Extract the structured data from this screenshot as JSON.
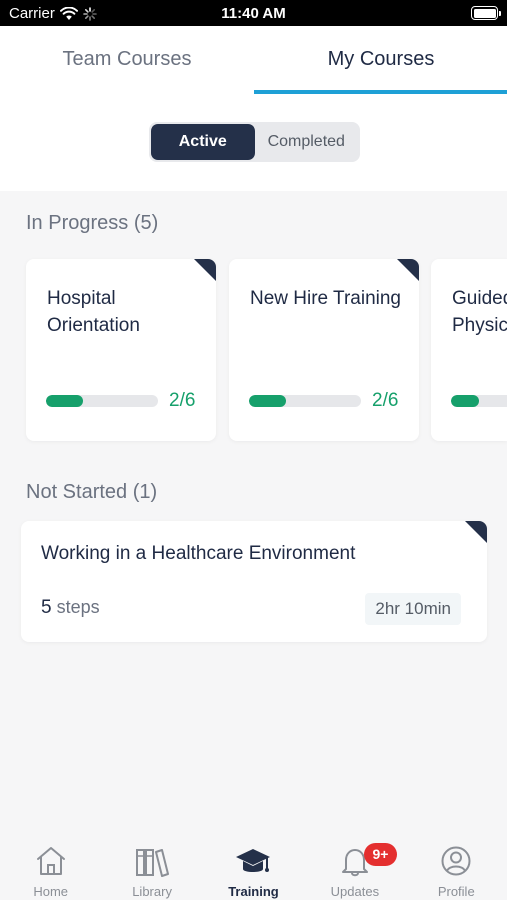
{
  "status_bar": {
    "carrier": "Carrier",
    "time": "11:40 AM"
  },
  "tabs": [
    {
      "label": "Team Courses",
      "selected": false
    },
    {
      "label": "My Courses",
      "selected": true
    }
  ],
  "filter": {
    "active_label": "Active",
    "completed_label": "Completed",
    "selected": "Active"
  },
  "in_progress": {
    "title": "In Progress (5)",
    "cards": [
      {
        "title": "Hospital Orientation",
        "progress_text": "2/6",
        "progress": 0.333
      },
      {
        "title": "New Hire Training",
        "progress_text": "2/6",
        "progress": 0.333
      },
      {
        "title": "Guided assisted Physic",
        "progress_text": "",
        "progress": 0.25
      }
    ]
  },
  "not_started": {
    "title": "Not Started (1)",
    "cards": [
      {
        "title": "Working in a Healthcare Environment",
        "steps_count": "5",
        "steps_label": "steps",
        "duration": "2hr 10min"
      }
    ]
  },
  "bottom_nav": {
    "items": [
      {
        "label": "Home",
        "icon": "home-icon"
      },
      {
        "label": "Library",
        "icon": "library-icon"
      },
      {
        "label": "Training",
        "icon": "graduation-cap-icon",
        "active": true
      },
      {
        "label": "Updates",
        "icon": "bell-icon"
      },
      {
        "label": "Profile",
        "icon": "profile-icon"
      }
    ],
    "updates_badge": "9+"
  },
  "colors": {
    "primary": "#243049",
    "accent_tab": "#1ea0d6",
    "progress": "#16a06b",
    "badge": "#e42f2f"
  }
}
